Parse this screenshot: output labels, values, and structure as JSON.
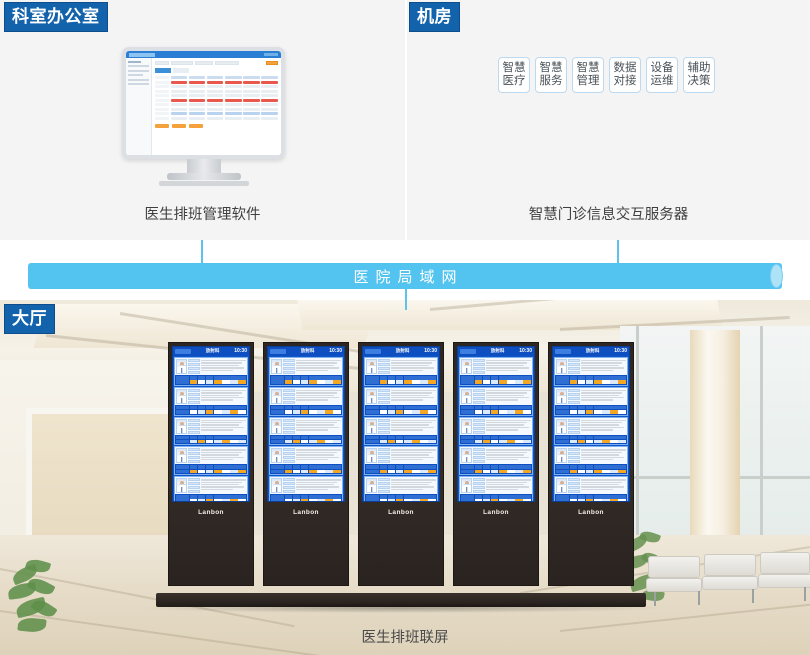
{
  "zones": {
    "office": {
      "tag": "科室办公室",
      "caption": "医生排班管理软件"
    },
    "server_room": {
      "tag": "机房",
      "caption": "智慧门诊信息交互服务器"
    },
    "lobby": {
      "tag": "大厅",
      "caption": "医生排班联屏"
    }
  },
  "capability_chips": [
    {
      "line1": "智慧",
      "line2": "医疗"
    },
    {
      "line1": "智慧",
      "line2": "服务"
    },
    {
      "line1": "智慧",
      "line2": "管理"
    },
    {
      "line1": "数据",
      "line2": "对接"
    },
    {
      "line1": "设备",
      "line2": "运维"
    },
    {
      "line1": "辅助",
      "line2": "决策"
    }
  ],
  "network": {
    "label": "医院局域网"
  },
  "signage": {
    "department": "放射科",
    "time": "10:30",
    "brand": "Lanbon",
    "screen_count": 5,
    "rows_per_screen": 6
  },
  "colors": {
    "tag_blue": "#1362ac",
    "lan_blue": "#53c3ef",
    "signage_blue": "#0d4fc0",
    "accent_orange": "#f5a623",
    "accent_red": "#e8453c"
  }
}
